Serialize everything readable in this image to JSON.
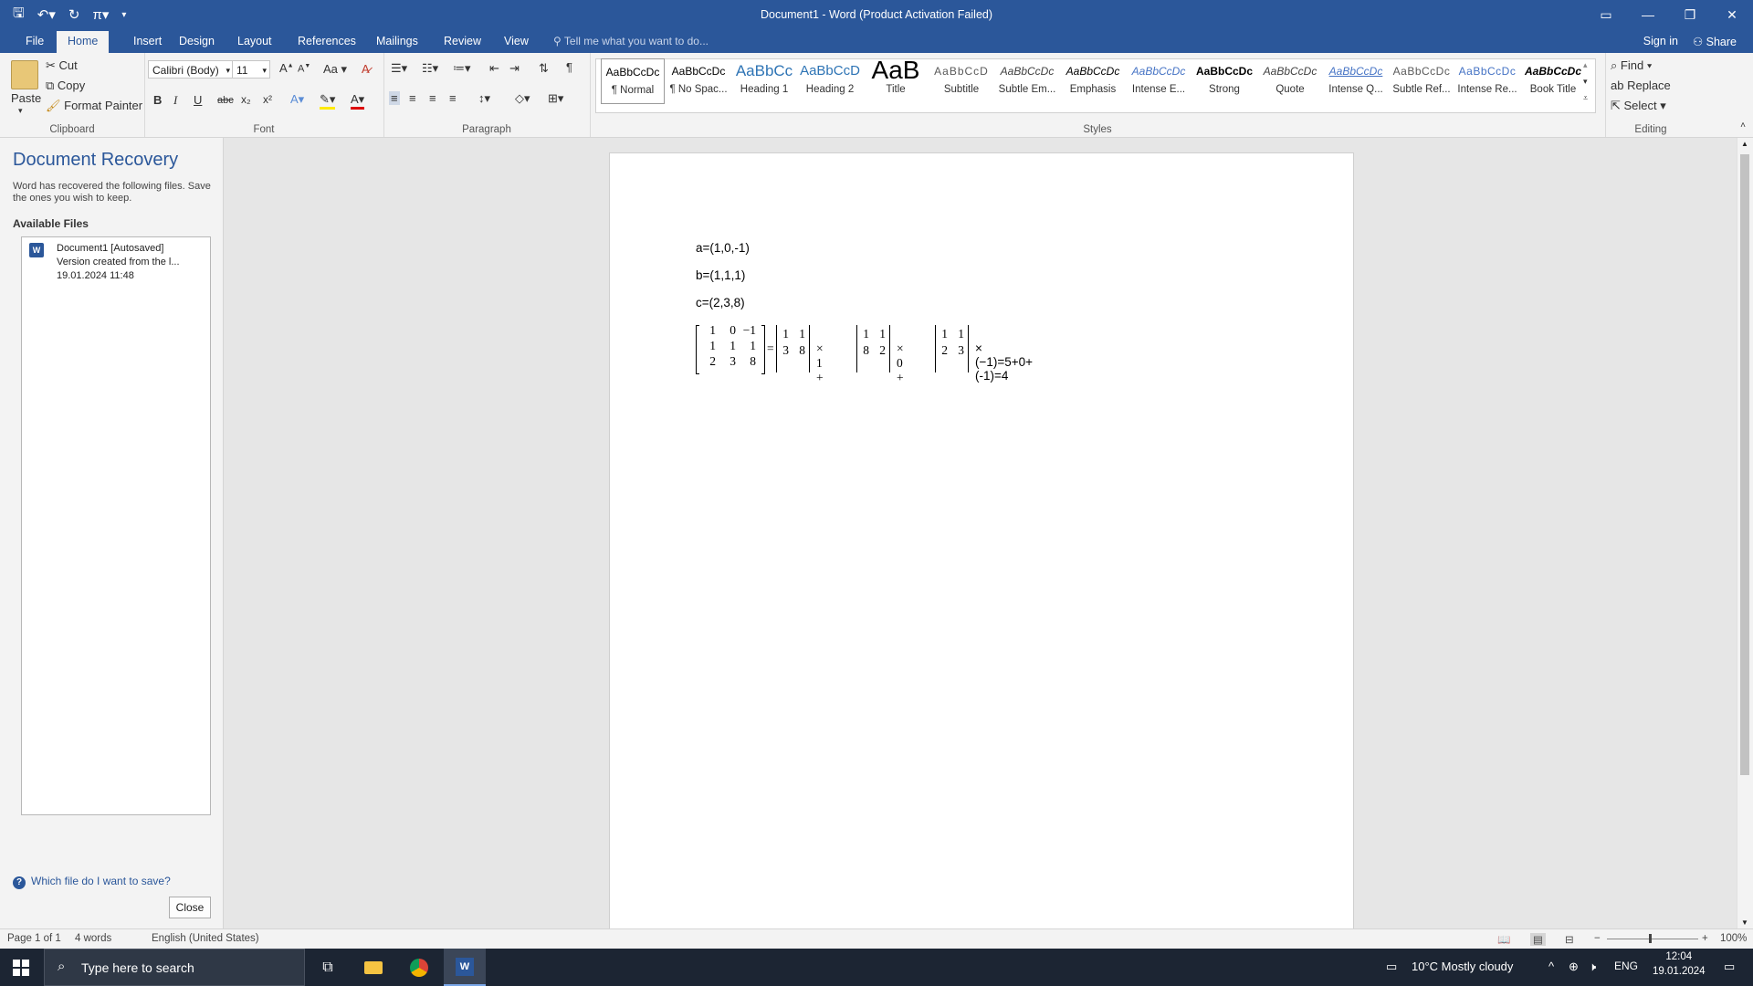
{
  "window": {
    "title": "Document1 - Word (Product Activation Failed)",
    "controls": {
      "minimize": "—",
      "restore": "❐",
      "close": "✕"
    }
  },
  "tabs": {
    "file": "File",
    "home": "Home",
    "insert": "Insert",
    "design": "Design",
    "layout": "Layout",
    "references": "References",
    "mailings": "Mailings",
    "review": "Review",
    "view": "View",
    "tell_me": "Tell me what you want to do...",
    "sign_in": "Sign in",
    "share": "Share"
  },
  "ribbon": {
    "clipboard": {
      "label": "Clipboard",
      "paste": "Paste",
      "cut": "Cut",
      "copy": "Copy",
      "format_painter": "Format Painter"
    },
    "font": {
      "label": "Font",
      "font_name": "Calibri (Body)",
      "font_size": "11",
      "bold": "B",
      "italic": "I",
      "underline": "U",
      "strike": "abc",
      "subscript": "x₂",
      "superscript": "x²",
      "change_case": "Aa"
    },
    "paragraph": {
      "label": "Paragraph"
    },
    "styles": {
      "label": "Styles",
      "items": [
        {
          "preview": "AaBbCcDc",
          "name": "¶ Normal"
        },
        {
          "preview": "AaBbCcDc",
          "name": "¶ No Spac..."
        },
        {
          "preview": "AaBbCc",
          "name": "Heading 1"
        },
        {
          "preview": "AaBbCcD",
          "name": "Heading 2"
        },
        {
          "preview": "AaB",
          "name": "Title"
        },
        {
          "preview": "AaBbCcD",
          "name": "Subtitle"
        },
        {
          "preview": "AaBbCcDc",
          "name": "Subtle Em..."
        },
        {
          "preview": "AaBbCcDc",
          "name": "Emphasis"
        },
        {
          "preview": "AaBbCcDc",
          "name": "Intense E..."
        },
        {
          "preview": "AaBbCcDc",
          "name": "Strong"
        },
        {
          "preview": "AaBbCcDc",
          "name": "Quote"
        },
        {
          "preview": "AaBbCcDc",
          "name": "Intense Q..."
        },
        {
          "preview": "AaBbCcDc",
          "name": "Subtle Ref..."
        },
        {
          "preview": "AaBbCcDc",
          "name": "Intense Re..."
        },
        {
          "preview": "AaBbCcDc",
          "name": "Book Title"
        }
      ]
    },
    "editing": {
      "label": "Editing",
      "find": "Find",
      "replace": "Replace",
      "select": "Select"
    }
  },
  "recovery": {
    "title": "Document Recovery",
    "description": "Word has recovered the following files. Save the ones you wish to keep.",
    "available_files": "Available Files",
    "file": {
      "name": "Document1  [Autosaved]",
      "version": "Version created from the l...",
      "date": "19.01.2024 11:48"
    },
    "help_link": "Which file do I want to save?",
    "close": "Close"
  },
  "document": {
    "lines": [
      "a=(1,0,-1)",
      "b=(1,1,1)",
      "c=(2,3,8)"
    ],
    "matrix": [
      [
        "1",
        "0",
        "−1"
      ],
      [
        "1",
        "1",
        "1"
      ],
      [
        "2",
        "3",
        "8"
      ]
    ],
    "eq_sign": "=",
    "det1": [
      [
        "1",
        "1"
      ],
      [
        "3",
        "8"
      ]
    ],
    "times1": "× 1 +",
    "det2": [
      [
        "1",
        "1"
      ],
      [
        "8",
        "2"
      ]
    ],
    "times2": "× 0 +",
    "det3": [
      [
        "1",
        "1"
      ],
      [
        "2",
        "3"
      ]
    ],
    "tail": "× (−1)=5+0+(-1)=4"
  },
  "status": {
    "page": "Page 1 of 1",
    "words": "4 words",
    "language": "English (United States)",
    "zoom": "100%"
  },
  "taskbar": {
    "search_placeholder": "Type here to search",
    "weather": "10°C  Mostly cloudy",
    "lang": "ENG",
    "time": "12:04",
    "date": "19.01.2024"
  }
}
